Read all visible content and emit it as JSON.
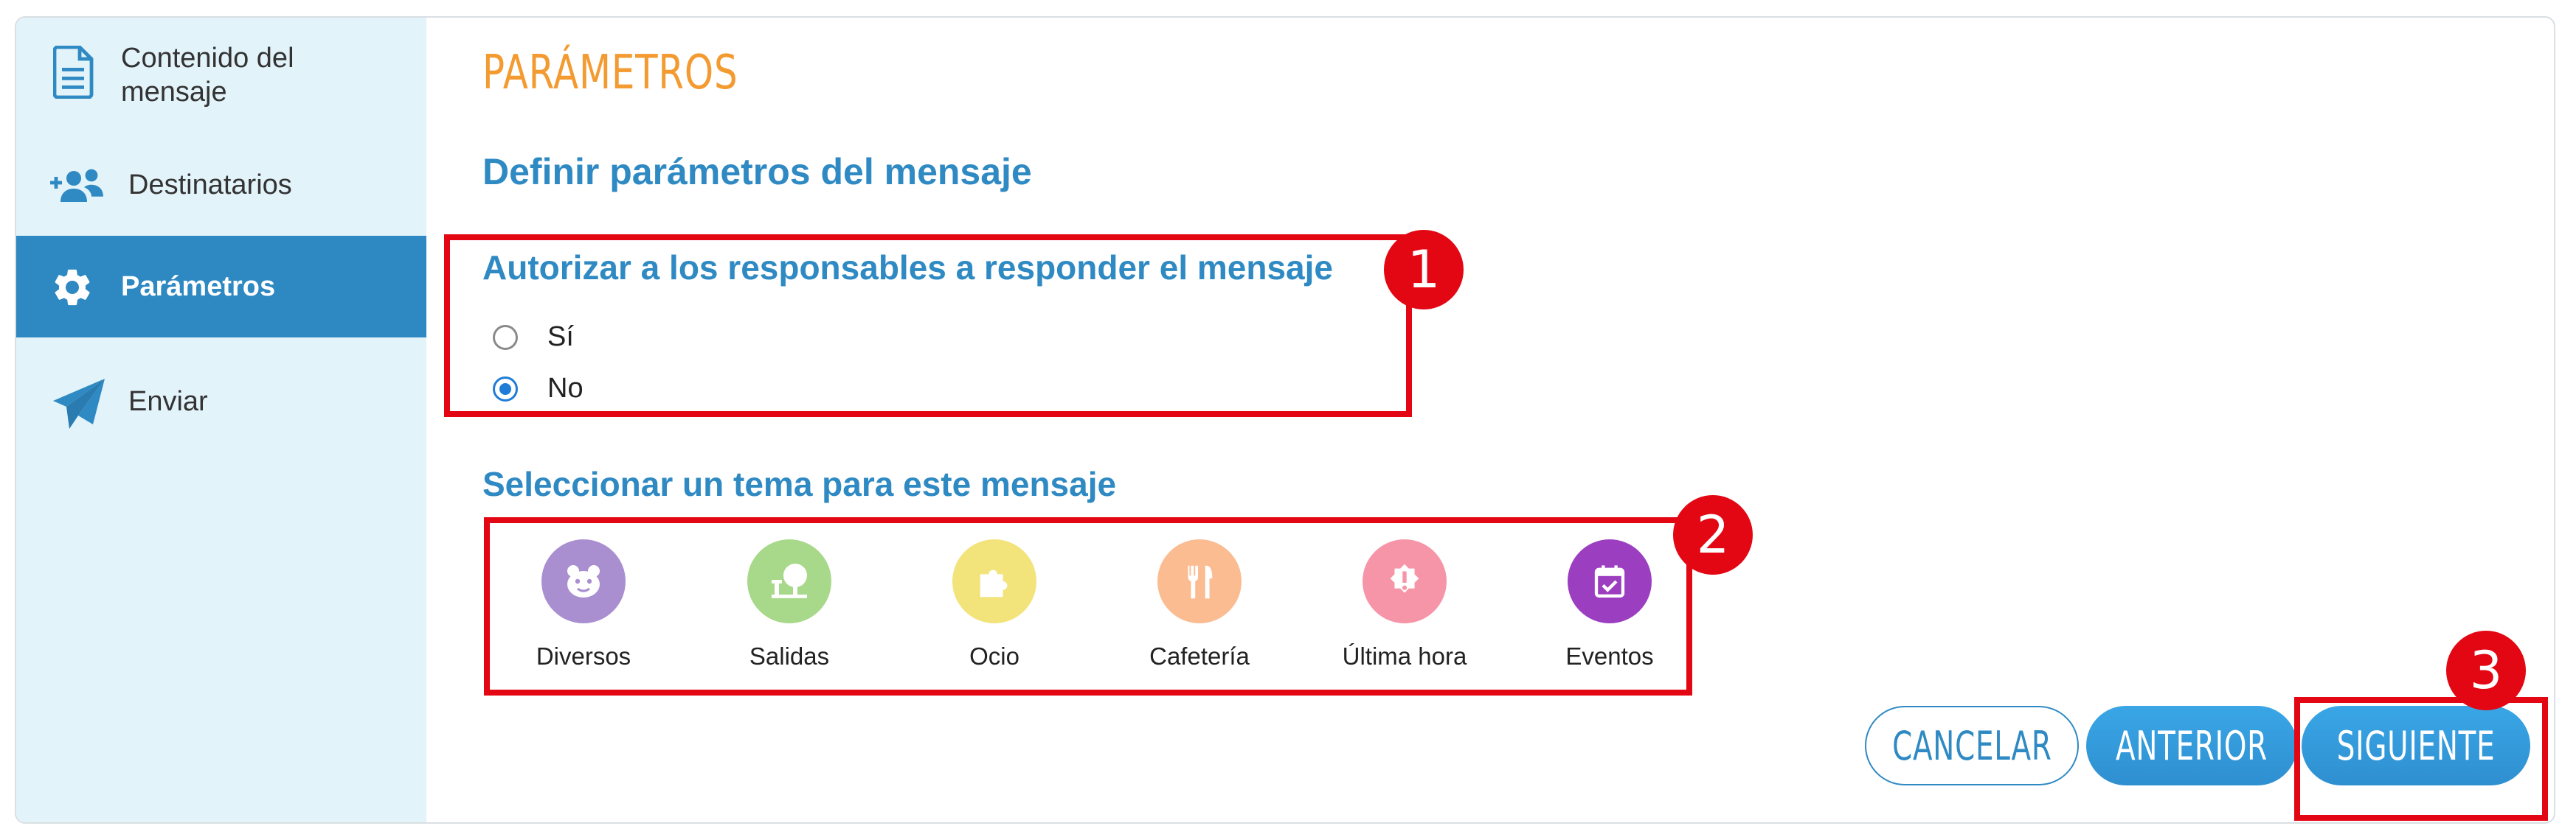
{
  "sidebar": {
    "items": [
      {
        "label_line1": "Contenido del",
        "label_line2": "mensaje",
        "icon": "document-icon"
      },
      {
        "label": "Destinatarios",
        "icon": "add-users-icon"
      },
      {
        "label": "Parámetros",
        "icon": "gear-icon",
        "active": true
      },
      {
        "label": "Enviar",
        "icon": "paper-plane-icon"
      }
    ]
  },
  "main": {
    "title": "PARÁMETROS",
    "subtitle": "Definir parámetros del mensaje",
    "reply": {
      "heading": "Autorizar a los responsables a responder el mensaje",
      "options": [
        "Sí",
        "No"
      ],
      "selected": "No"
    },
    "theme": {
      "heading": "Seleccionar un tema para este mensaje",
      "items": [
        {
          "label": "Diversos",
          "icon": "smiley-bear-icon",
          "color": "#a98fd0"
        },
        {
          "label": "Salidas",
          "icon": "tree-icon",
          "color": "#a8d98a"
        },
        {
          "label": "Ocio",
          "icon": "puzzle-icon",
          "color": "#f2e37a"
        },
        {
          "label": "Cafetería",
          "icon": "cutlery-icon",
          "color": "#fbbc91"
        },
        {
          "label": "Última hora",
          "icon": "alert-badge-icon",
          "color": "#f795a8"
        },
        {
          "label": "Eventos",
          "icon": "calendar-check-icon",
          "color": "#9b3fc0"
        }
      ]
    }
  },
  "buttons": {
    "cancel": "CANCELAR",
    "previous": "ANTERIOR",
    "next": "SIGUIENTE"
  },
  "annotations": [
    "1",
    "2",
    "3"
  ],
  "colors": {
    "sidebar_bg": "#e3f3fa",
    "sidebar_active": "#2e88c2",
    "title": "#f39a31",
    "heading": "#2f8ac3",
    "annotation_red": "#e30613"
  }
}
